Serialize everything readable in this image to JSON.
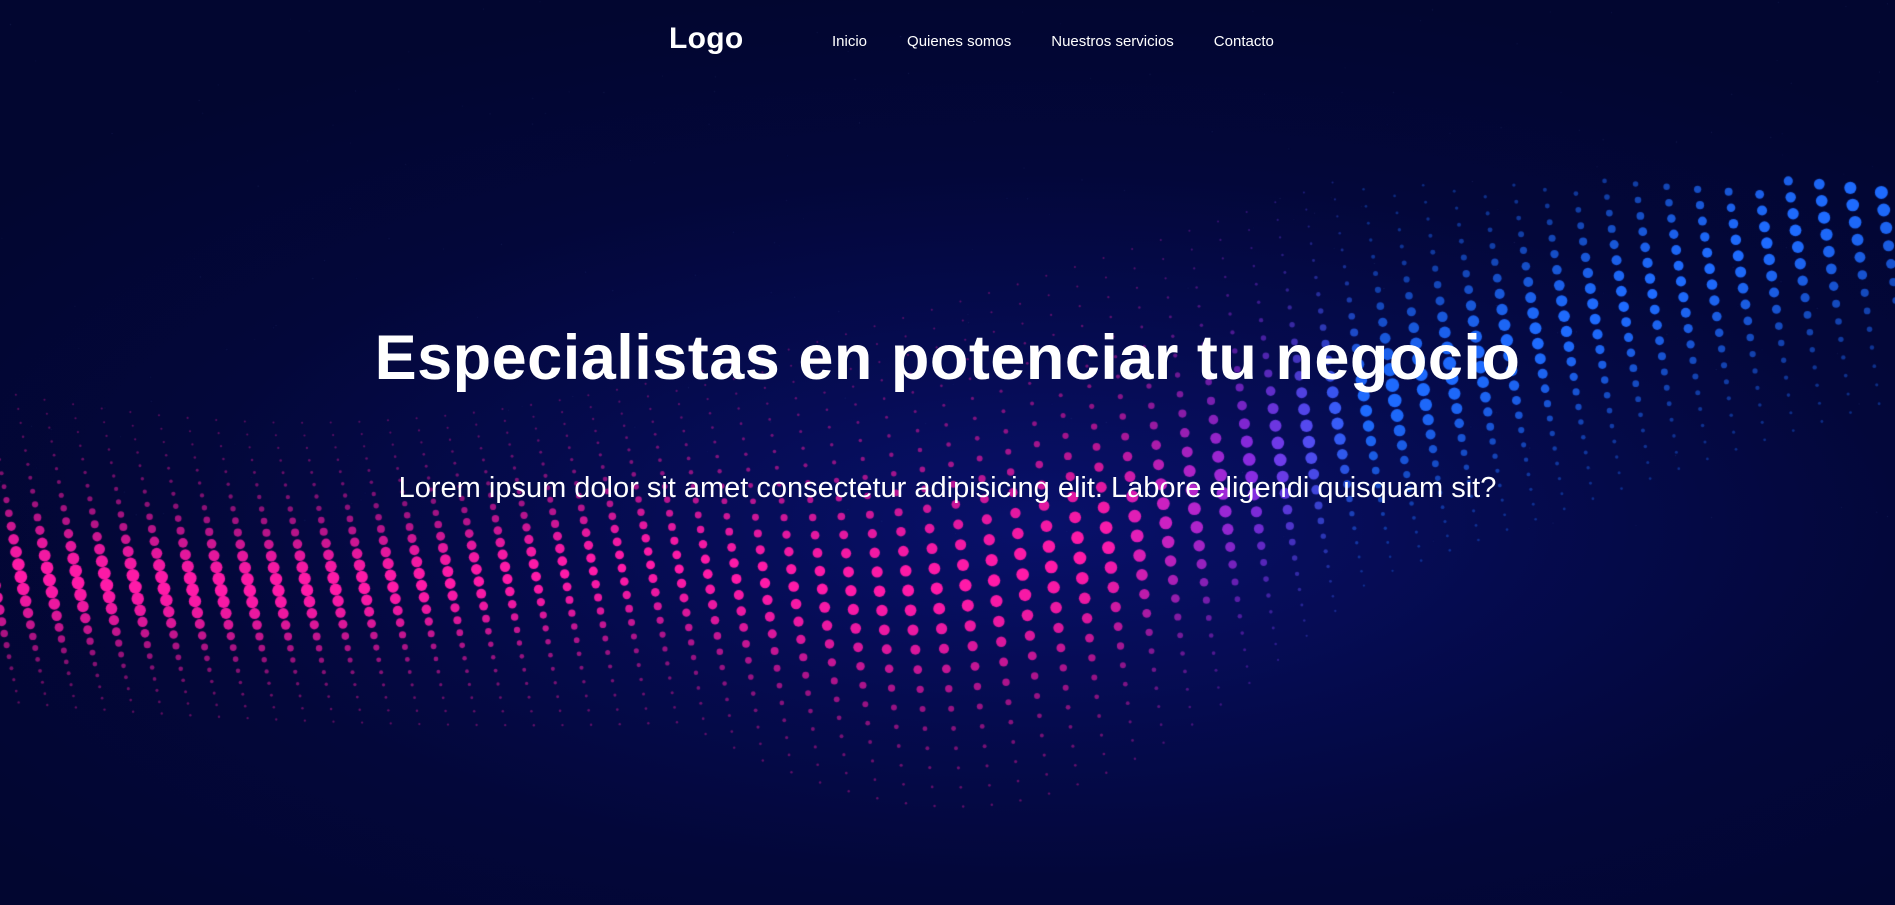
{
  "navbar": {
    "logo": "Logo",
    "links": [
      {
        "label": "Inicio"
      },
      {
        "label": "Quienes somos"
      },
      {
        "label": "Nuestros servicios"
      },
      {
        "label": "Contacto"
      }
    ]
  },
  "hero": {
    "title": "Especialistas en potenciar tu negocio",
    "subtitle": "Lorem ipsum dolor sit amet consectetur adipisicing elit. Labore eligendi quisquam sit?"
  },
  "colors": {
    "background": "#03062f",
    "dot_pink": "#ff1aa8",
    "dot_purple": "#8a2be2",
    "dot_blue": "#1e6bff",
    "text": "#ffffff"
  }
}
